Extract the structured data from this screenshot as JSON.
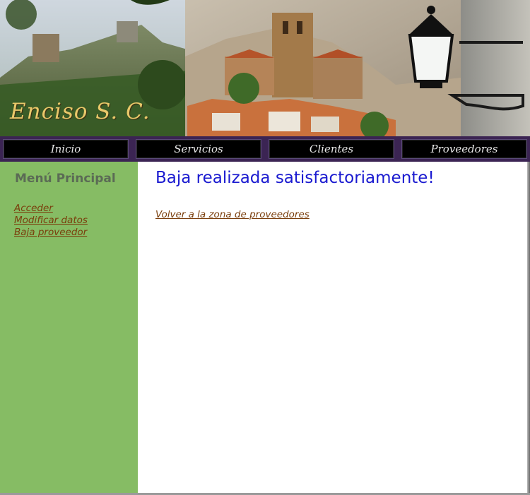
{
  "banner": {
    "title": "Enciso S. C."
  },
  "nav": {
    "items": [
      {
        "label": "Inicio"
      },
      {
        "label": "Servicios"
      },
      {
        "label": "Clientes"
      },
      {
        "label": "Proveedores"
      }
    ]
  },
  "sidebar": {
    "title": "Menú Principal",
    "links": [
      {
        "label": "Acceder"
      },
      {
        "label": "Modificar datos"
      },
      {
        "label": "Baja proveedor"
      }
    ]
  },
  "main": {
    "heading": "Baja realizada satisfactoriamente!",
    "back_link": "Volver a la zona de proveedores"
  },
  "colors": {
    "sidebar_bg": "#86bc64",
    "heading_blue": "#1a1ad0",
    "link_brown": "#7a3e0c",
    "nav_bg": "#3b2453"
  }
}
